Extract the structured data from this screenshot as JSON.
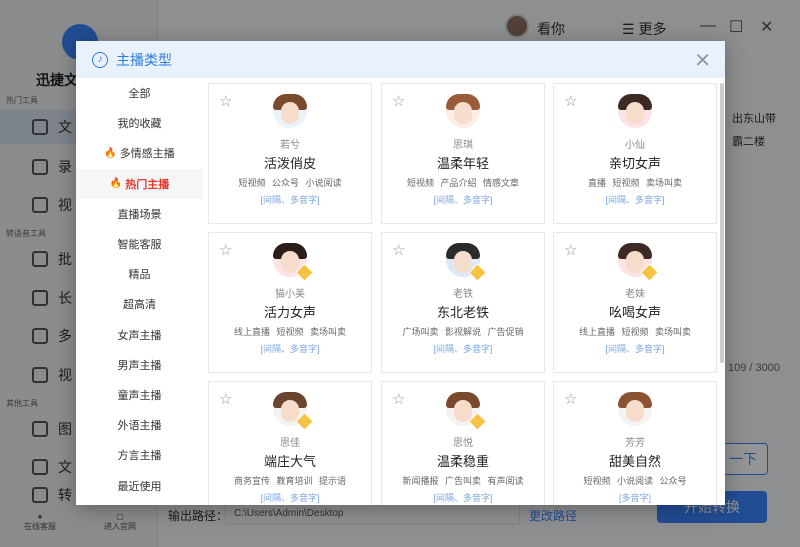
{
  "background": {
    "brand": "迅捷文字",
    "sections": [
      "热门工具",
      "转语音工具",
      "其他工具"
    ],
    "sidebar_items": [
      "文",
      "录",
      "视",
      "批",
      "长",
      "多",
      "视",
      "图",
      "文",
      "转"
    ],
    "bottom_buttons": [
      "在线客服",
      "进入官网"
    ],
    "user_name": "看你",
    "more_label": "更多",
    "text_snippet_1": "出东山带",
    "text_snippet_2": "霸二楼",
    "counter": "109 / 3000",
    "next_label": "一下",
    "output_label": "输出路径：",
    "output_path": "C:\\Users\\Admin\\Desktop",
    "change_path": "更改路径",
    "convert_label": "开始转换"
  },
  "modal": {
    "title": "主播类型",
    "categories": [
      {
        "label": "全部",
        "hot": false,
        "active": false
      },
      {
        "label": "我的收藏",
        "hot": false,
        "active": false
      },
      {
        "label": "多情感主播",
        "hot": true,
        "active": false
      },
      {
        "label": "热门主播",
        "hot": true,
        "active": true
      },
      {
        "label": "直播场景",
        "hot": false,
        "active": false
      },
      {
        "label": "智能客服",
        "hot": false,
        "active": false
      },
      {
        "label": "精品",
        "hot": false,
        "active": false
      },
      {
        "label": "超高清",
        "hot": false,
        "active": false
      },
      {
        "label": "女声主播",
        "hot": false,
        "active": false
      },
      {
        "label": "男声主播",
        "hot": false,
        "active": false
      },
      {
        "label": "童声主播",
        "hot": false,
        "active": false
      },
      {
        "label": "外语主播",
        "hot": false,
        "active": false
      },
      {
        "label": "方言主播",
        "hot": false,
        "active": false
      },
      {
        "label": "最近使用",
        "hot": false,
        "active": false
      }
    ],
    "voices": [
      {
        "name": "若兮",
        "style": "活泼俏皮",
        "tags": "短视频 公众号 小说阅读",
        "features": "[间隔、多音字]",
        "avatar_bg": "#e9f3fb",
        "hair": "#7a4a2e",
        "vip": false
      },
      {
        "name": "思琪",
        "style": "温柔年轻",
        "tags": "短视频 产品介绍 情感文章",
        "features": "[间隔、多音字]",
        "avatar_bg": "#fbeee6",
        "hair": "#9a5b3a",
        "vip": false
      },
      {
        "name": "小仙",
        "style": "亲切女声",
        "tags": "直播 短视频 卖场叫卖",
        "features": "[间隔、多音字]",
        "avatar_bg": "#fde2e6",
        "hair": "#3d2a24",
        "vip": false
      },
      {
        "name": "猫小美",
        "style": "活力女声",
        "tags": "线上直播 短视频 卖场叫卖",
        "features": "[间隔、多音字]",
        "avatar_bg": "#fde2e6",
        "hair": "#2b1d18",
        "vip": true
      },
      {
        "name": "老铁",
        "style": "东北老铁",
        "tags": "广场叫卖 影视解说 广告促销",
        "features": "[间隔、多音字]",
        "avatar_bg": "#dbe9fb",
        "hair": "#2b2b2b",
        "vip": true
      },
      {
        "name": "老妹",
        "style": "吆喝女声",
        "tags": "线上直播 短视频 卖场叫卖",
        "features": "[间隔、多音字]",
        "avatar_bg": "#fde2e6",
        "hair": "#3d2a24",
        "vip": true
      },
      {
        "name": "思佳",
        "style": "端庄大气",
        "tags": "商务宣传 教育培训 提示语",
        "features": "[间隔、多音字]",
        "avatar_bg": "#f3f3f3",
        "hair": "#6b4430",
        "vip": true
      },
      {
        "name": "思悦",
        "style": "温柔稳重",
        "tags": "新闻播报 广告叫卖 有声阅读",
        "features": "[间隔、多音字]",
        "avatar_bg": "#f3f3f3",
        "hair": "#7a4a2e",
        "vip": true
      },
      {
        "name": "芳芳",
        "style": "甜美自然",
        "tags": "短视频 小说阅读 公众号",
        "features": "[多音字]",
        "avatar_bg": "#f3f3f3",
        "hair": "#8a5232",
        "vip": false
      }
    ]
  }
}
